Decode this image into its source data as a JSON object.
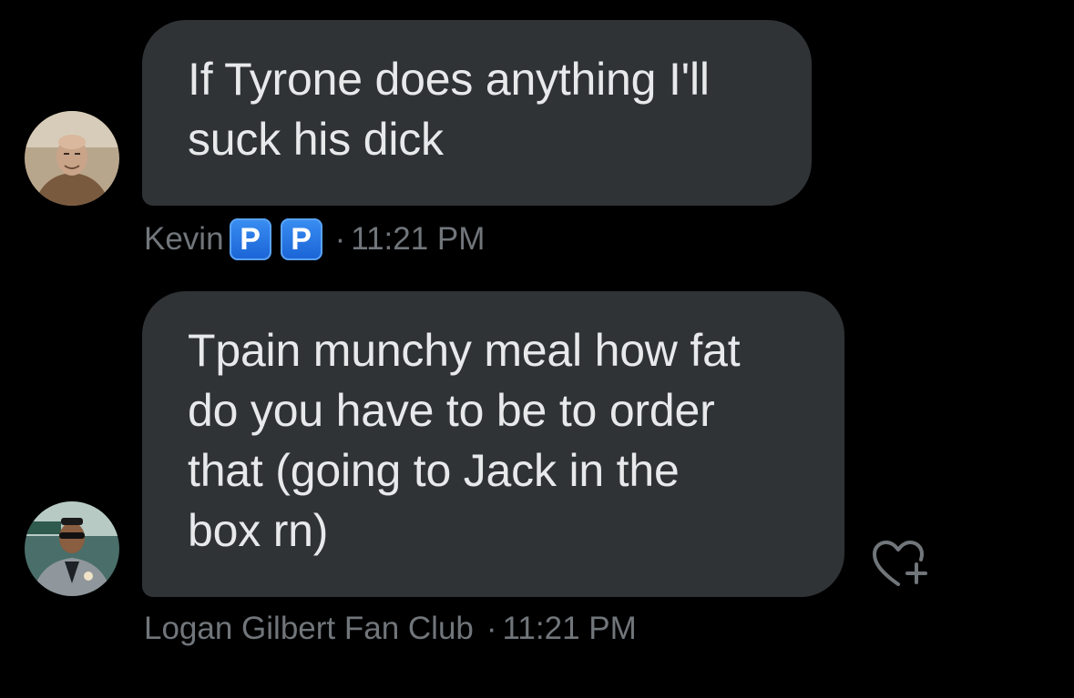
{
  "messages": [
    {
      "text_lines": [
        "If Tyrone does anything I'll",
        "suck his dick"
      ],
      "sender": "Kevin",
      "badges": [
        "P",
        "P"
      ],
      "separator": "·",
      "time": "11:21 PM",
      "avatar_icon": "avatar-bald-man-hoodie"
    },
    {
      "text_lines": [
        "Tpain munchy meal how fat",
        "do you have to be to order",
        "that (going to Jack in the",
        "box rn)"
      ],
      "sender": "Logan Gilbert Fan Club",
      "separator": "·",
      "time": "11:21 PM",
      "avatar_icon": "avatar-man-suit-sunglasses"
    }
  ],
  "reaction_icon": "heart-plus-icon",
  "colors": {
    "background": "#000000",
    "bubble": "#2f3336",
    "text": "#e7e9ea",
    "meta_text": "#71767b",
    "badge_blue": "#1d6fe0"
  }
}
